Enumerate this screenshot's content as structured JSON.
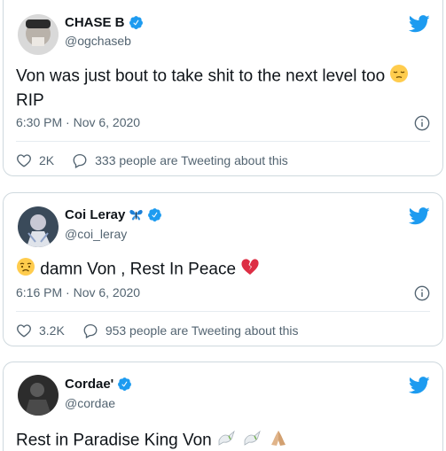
{
  "tweets": [
    {
      "name": "CHASE B",
      "handle": "@ogchaseb",
      "text": "Von was just bout to take shit to the next level too",
      "text_line2": "RIP",
      "time": "6:30 PM · Nov 6, 2020",
      "likes": "2K",
      "tweeting": "333 people are Tweeting about this"
    },
    {
      "name": "Coi Leray",
      "handle": "@coi_leray",
      "text": "damn Von , Rest In Peace",
      "time": "6:16 PM · Nov 6, 2020",
      "likes": "3.2K",
      "tweeting": "953 people are Tweeting about this"
    },
    {
      "name": "Cordae'",
      "handle": "@cordae",
      "text": "Rest in Paradise King Von"
    }
  ],
  "colors": {
    "twitter_blue": "#1d9bf0",
    "text_primary": "#0f1419",
    "text_secondary": "#536471",
    "border": "#cfd9de"
  },
  "icons": {
    "brand": "twitter-bird-icon",
    "verified": "verified-badge-icon",
    "info": "info-icon",
    "like": "heart-icon",
    "reply": "speech-bubble-icon"
  }
}
